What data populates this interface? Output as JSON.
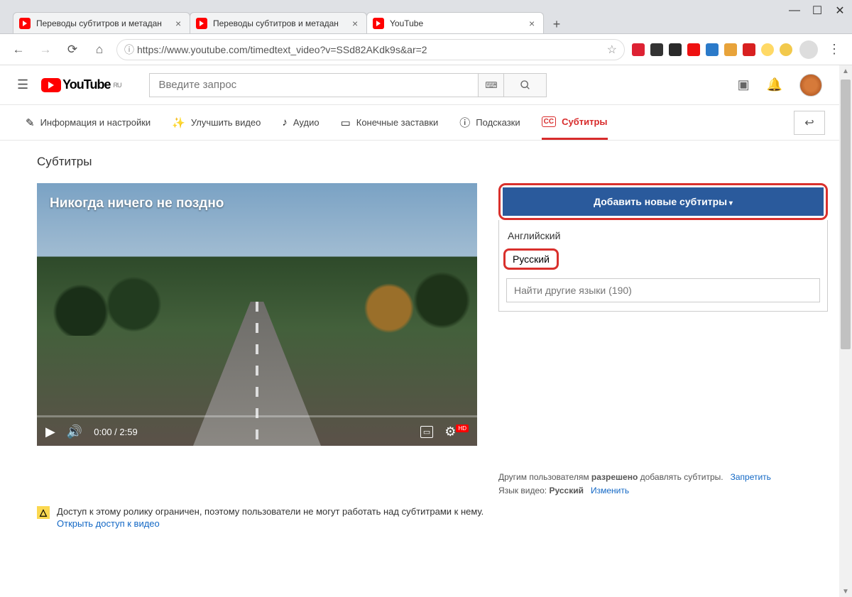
{
  "browser": {
    "tabs": [
      {
        "title": "Переводы субтитров и метадан",
        "active": false
      },
      {
        "title": "Переводы субтитров и метадан",
        "active": false
      },
      {
        "title": "YouTube",
        "active": true
      }
    ],
    "url_display": "https://www.youtube.com/timedtext_video?v=SSd82AKdk9s&ar=2"
  },
  "yt_header": {
    "logo_text": "YouTube",
    "logo_region": "RU",
    "search_placeholder": "Введите запрос"
  },
  "studio_tabs": {
    "info": "Информация и настройки",
    "enhance": "Улучшить видео",
    "audio": "Аудио",
    "endscreens": "Конечные заставки",
    "cards": "Подсказки",
    "subtitles": "Субтитры"
  },
  "page": {
    "heading": "Субтитры",
    "video_title": "Никогда ничего не поздно",
    "player_time": "0:00 / 2:59"
  },
  "right": {
    "add_button": "Добавить новые субтитры",
    "lang_en": "Английский",
    "lang_ru": "Русский",
    "search_placeholder": "Найти другие языки (190)",
    "meta_line1_a": "Другим пользователям ",
    "meta_line1_b": "разрешено",
    "meta_line1_c": " добавлять субтитры.",
    "meta_link1": "Запретить",
    "meta_line2_a": "Язык видео: ",
    "meta_line2_b": "Русский",
    "meta_link2": "Изменить"
  },
  "warning": {
    "text": "Доступ к этому ролику ограничен, поэтому пользователи не могут работать над субтитрами к нему.",
    "link": "Открыть доступ к видео"
  }
}
